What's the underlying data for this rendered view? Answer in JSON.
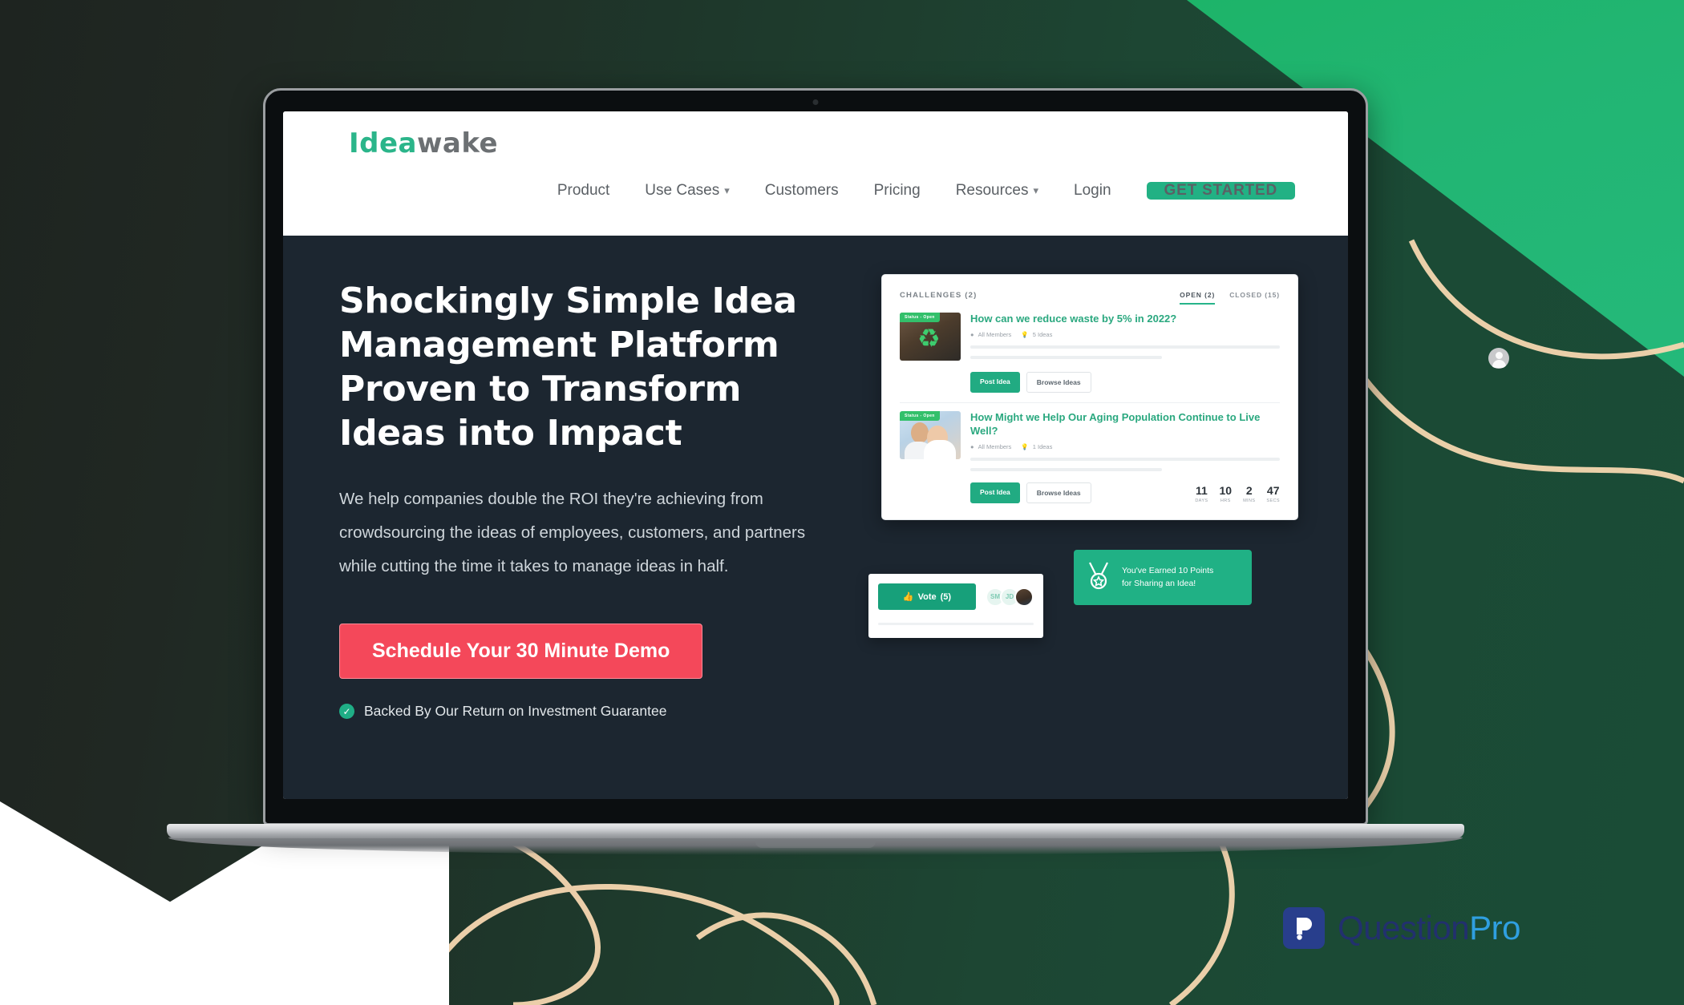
{
  "background": {
    "dark_gradient_start": "#1e2420",
    "dark_gradient_end": "#1a4c36",
    "accent_green": "#22b573",
    "deco_curve_color": "#f5d5aa"
  },
  "site": {
    "logo": {
      "part_a": "Idea",
      "part_b": "wake",
      "color_a": "#2bb58a",
      "color_b": "#6c7073"
    },
    "nav": [
      {
        "label": "Product",
        "has_caret": false
      },
      {
        "label": "Use Cases",
        "has_caret": true,
        "caret": "▾"
      },
      {
        "label": "Customers",
        "has_caret": false
      },
      {
        "label": "Pricing",
        "has_caret": false
      },
      {
        "label": "Resources",
        "has_caret": true,
        "caret": "▾"
      },
      {
        "label": "Login",
        "has_caret": false
      }
    ],
    "cta_nav": {
      "label": "GET STARTED",
      "color": "#22b184"
    }
  },
  "hero": {
    "headline": "Shockingly Simple Idea Management Platform Proven to Transform Ideas into Impact",
    "subcopy": "We help companies double the ROI they're achieving from crowdsourcing the ideas of employees, customers, and partners while cutting the time it takes to manage ideas in half.",
    "cta": {
      "label": "Schedule Your 30 Minute Demo",
      "color": "#f4485a"
    },
    "guarantee": {
      "icon": "check-circle-icon",
      "text": "Backed By Our Return on Investment Guarantee"
    },
    "background_color": "#1c2630"
  },
  "app_mockup": {
    "header": {
      "title": "CHALLENGES (2)"
    },
    "tabs": [
      {
        "label": "OPEN (2)",
        "active": true
      },
      {
        "label": "CLOSED (15)",
        "active": false
      }
    ],
    "challenges": [
      {
        "tag": "Status - Open",
        "title": "How can we reduce waste by 5% in 2022?",
        "audience": "All Members",
        "ideas": "5 Ideas",
        "buttons": {
          "primary": "Post Idea",
          "secondary": "Browse Ideas"
        },
        "thumb_icon": "recycle-icon"
      },
      {
        "tag": "Status - Open",
        "title": "How Might we Help Our Aging Population Continue to Live Well?",
        "audience": "All Members",
        "ideas": "1 Ideas",
        "buttons": {
          "primary": "Post Idea",
          "secondary": "Browse Ideas"
        },
        "thumb_icon": "people-photo"
      }
    ],
    "countdown": [
      {
        "value": "11",
        "label": "Days"
      },
      {
        "value": "10",
        "label": "Hrs"
      },
      {
        "value": "2",
        "label": "Mins"
      },
      {
        "value": "47",
        "label": "Secs"
      }
    ],
    "vote_widget": {
      "button_label": "Vote",
      "count": "(5)",
      "icon": "thumbs-up-icon",
      "avatars": [
        "SM",
        "JD",
        ""
      ]
    },
    "points_badge": {
      "icon": "medal-icon",
      "line1": "You've Earned 10 Points",
      "line2": "for Sharing an Idea!",
      "color": "#20b185"
    }
  },
  "footer_brand": {
    "mark_glyph": "P?",
    "word_a": "Question",
    "word_b": "Pro",
    "color_a": "#22306e",
    "color_b": "#2f9fe0",
    "mark_bg": "#283e8c"
  }
}
